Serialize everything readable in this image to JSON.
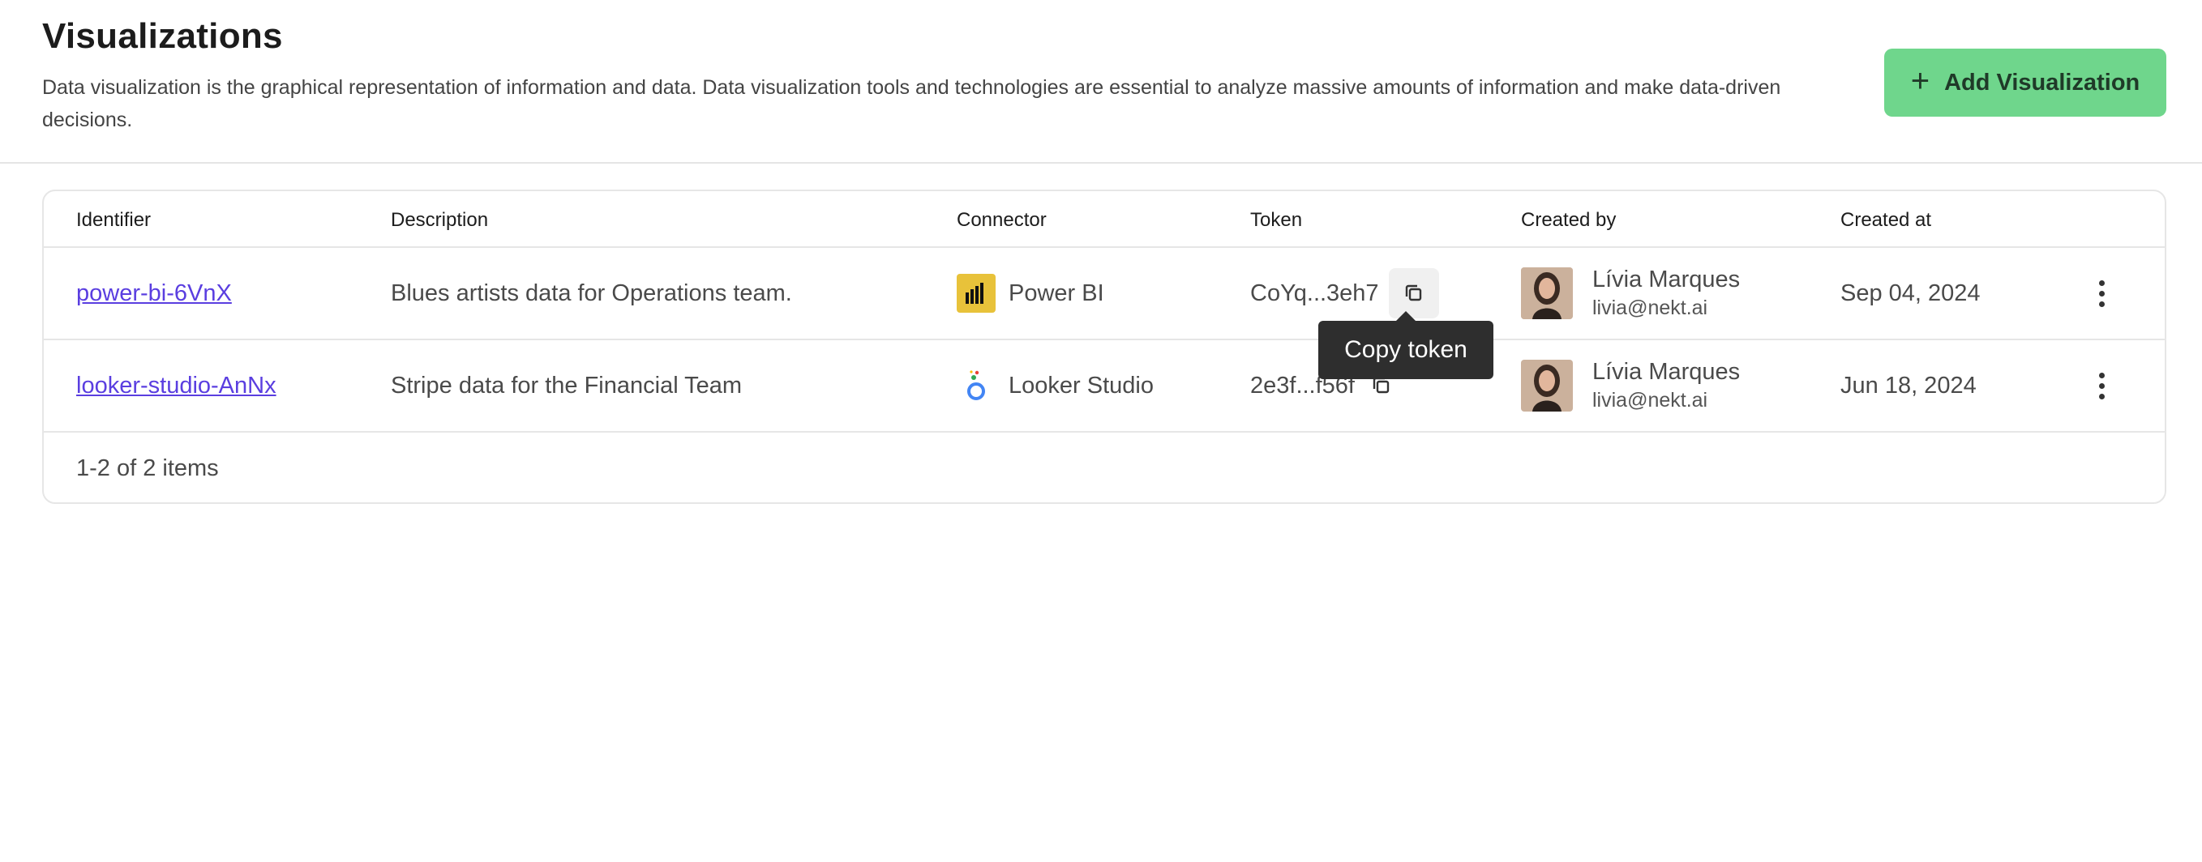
{
  "header": {
    "title": "Visualizations",
    "description": "Data visualization is the graphical representation of information and data. Data visualization tools and technologies are essential to analyze massive amounts of information and make data-driven decisions.",
    "add_button_label": "Add Visualization",
    "add_button_icon": "plus-icon"
  },
  "table": {
    "columns": [
      "Identifier",
      "Description",
      "Connector",
      "Token",
      "Created by",
      "Created at"
    ],
    "rows": [
      {
        "identifier": "power-bi-6VnX",
        "description": "Blues artists data for Operations team.",
        "connector": "Power BI",
        "connector_icon": "power-bi-icon",
        "token": "CoYq...3eh7",
        "created_by_name": "Lívia Marques",
        "created_by_email": "livia@nekt.ai",
        "created_at": "Sep 04, 2024"
      },
      {
        "identifier": "looker-studio-AnNx",
        "description": "Stripe data for the Financial Team",
        "connector": "Looker Studio",
        "connector_icon": "looker-studio-icon",
        "token": "2e3f...f56f",
        "created_by_name": "Lívia Marques",
        "created_by_email": "livia@nekt.ai",
        "created_at": "Jun 18, 2024"
      }
    ],
    "footer": "1-2 of 2 items"
  },
  "tooltip": {
    "text": "Copy token"
  },
  "colors": {
    "accent_button": "#6fd68c",
    "link": "#5a3ee0",
    "power_bi": "#e8c23a",
    "tooltip_bg": "#2e2e2e"
  }
}
